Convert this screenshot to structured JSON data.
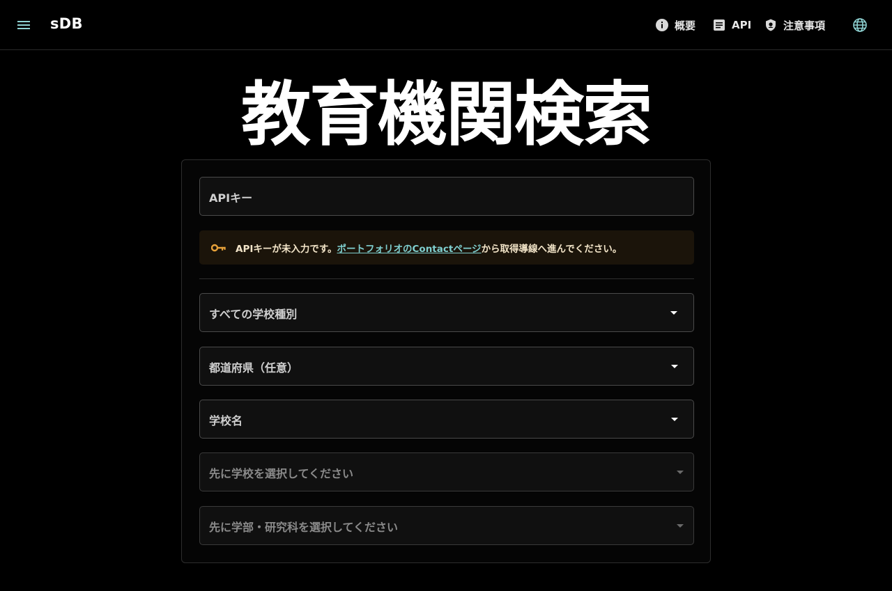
{
  "app": {
    "brand": "sDB"
  },
  "nav": {
    "overview": "概要",
    "api": "API",
    "notes": "注意事項"
  },
  "page": {
    "title": "教育機関検索"
  },
  "form": {
    "api_key_placeholder": "APIキー",
    "alert": {
      "prefix": "APIキーが未入力です。",
      "link": "ポートフォリオのContactページ",
      "suffix": "から取得導線へ進んでください。"
    },
    "school_type": "すべての学校種別",
    "prefecture": "都道府県（任意）",
    "school_name": "学校名",
    "faculty": "先に学校を選択してください",
    "department": "先に学部・研究科を選択してください"
  },
  "colors": {
    "background": "#000000",
    "accent": "#7fcfcf",
    "warning_icon": "#e8a23a"
  }
}
